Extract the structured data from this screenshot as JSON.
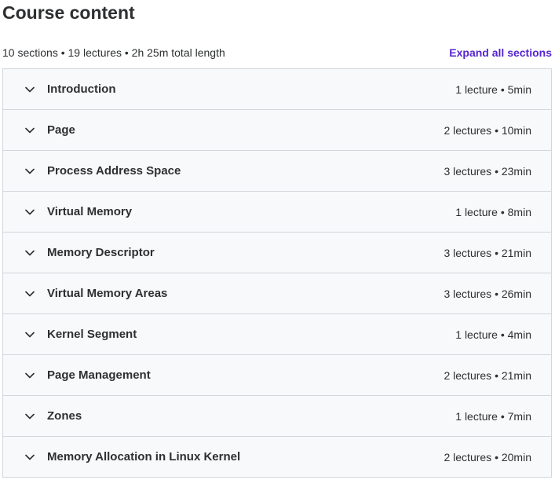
{
  "header": {
    "title": "Course content",
    "summary": "10 sections • 19 lectures • 2h 25m total length",
    "expand_label": "Expand all sections"
  },
  "sections": [
    {
      "title": "Introduction",
      "meta": "1 lecture • 5min"
    },
    {
      "title": "Page",
      "meta": "2 lectures • 10min"
    },
    {
      "title": "Process Address Space",
      "meta": "3 lectures • 23min"
    },
    {
      "title": "Virtual Memory",
      "meta": "1 lecture • 8min"
    },
    {
      "title": "Memory Descriptor",
      "meta": "3 lectures • 21min"
    },
    {
      "title": "Virtual Memory Areas",
      "meta": "3 lectures • 26min"
    },
    {
      "title": "Kernel Segment",
      "meta": "1 lecture • 4min"
    },
    {
      "title": "Page Management",
      "meta": "2 lectures • 21min"
    },
    {
      "title": "Zones",
      "meta": "1 lecture • 7min"
    },
    {
      "title": "Memory Allocation in Linux Kernel",
      "meta": "2 lectures • 20min"
    }
  ],
  "icons": {
    "section_toggle": "chevron-down-icon"
  },
  "colors": {
    "accent": "#5624d0",
    "text": "#2d2f31",
    "section_bg": "#f7f9fa",
    "border": "#d1d7dc"
  }
}
